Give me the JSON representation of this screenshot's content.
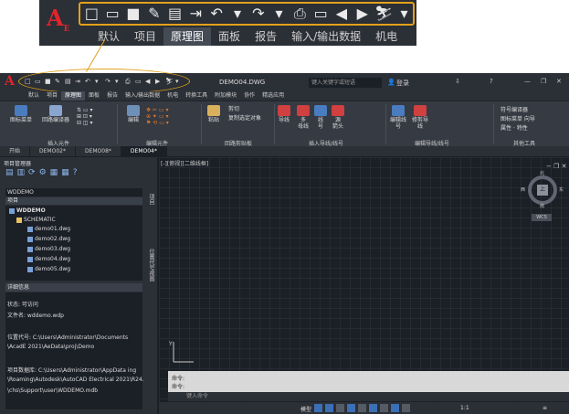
{
  "zoom": {
    "qa_icons": [
      "□",
      "▭",
      "■",
      "✎",
      "▤",
      "⇥",
      "↶",
      "▾",
      "↷",
      "▾",
      "⎙",
      "▭",
      "◀",
      "▶",
      "⛷",
      "▾"
    ],
    "tabs": [
      "默认",
      "项目",
      "原理图",
      "面板",
      "报告",
      "输入/输出数据",
      "机电"
    ],
    "active_tab": "原理图",
    "logo": "A",
    "logo_sub": "E"
  },
  "app": {
    "title": "DEMO04.DWG",
    "search_placeholder": "键入关键字或短语",
    "login": "登录",
    "ribbon_tabs": [
      "默认",
      "项目",
      "原理图",
      "面板",
      "报告",
      "输入/输出数据",
      "机电",
      "转换工具",
      "附加模块",
      "协作",
      "精选应用",
      ""
    ],
    "active_ribbon_tab": "原理图",
    "panels": {
      "insert": "插入元件",
      "edit": "编辑元件",
      "clipboard": "回路剪贴板",
      "wire": "插入导线/线号",
      "edit_wire": "编辑导线/线号",
      "other": "其他工具"
    },
    "buttons": {
      "icon_menu": "图标菜单",
      "circuit_builder": "回路编译器",
      "edit": "编辑",
      "paste": "粘贴",
      "cut": "剪切",
      "copy_clip": "复制选定对象",
      "wire": "导线",
      "multi": "多",
      "multi2": "母线",
      "line": "线",
      "line2": "号",
      "source": "源",
      "source2": "箭头",
      "edit_wire": "编辑线",
      "edit_wire2": "号",
      "modify_wire": "修剪导",
      "modify_wire2": "线",
      "symbol_builder": "符号编译器",
      "icon_menu_wizard": "图标菜单 向导",
      "attributes": "属性 · 特性"
    },
    "doc_tabs": [
      "开始",
      "DEMO02*",
      "DEMO08*",
      "DEMO04*"
    ],
    "active_doc": "DEMO04*",
    "project_manager": {
      "title": "项目管理器",
      "project": "WDDEMO",
      "section": "项目",
      "root": "WDDEMO",
      "folder": "SCHEMATIC",
      "files": [
        "demo01.dwg",
        "demo02.dwg",
        "demo03.dwg",
        "demo04.dwg",
        "demo05.dwg"
      ]
    },
    "details": {
      "title": "详细信息",
      "status": "状态: 可访问",
      "filename": "文件名: wddemo.wdp",
      "location_1": "位置代号: C:\\Users\\Administrator\\Documents",
      "location_2": "\\AcadE 2021\\AeData\\proj\\Demo",
      "db_1": "项目数据库: C:\\Users\\Administrator\\AppData ing",
      "db_2": "\\Roaming\\Autodesk\\AutoCAD Electrical 2021\\R24.0",
      "db_3": "\\chs\\Support\\user\\WDDEMO.mdb"
    },
    "side_labels": [
      "项目",
      "位置代号视图"
    ],
    "viewport": "[-][俯视][二维线框]",
    "view_cube": {
      "top": "上",
      "n": "北",
      "e": "东",
      "w": "西",
      "s": "南",
      "wcs": "WCS"
    },
    "command_history": [
      "命令:",
      "命令:"
    ],
    "command_input": "键入命令",
    "model": "模型",
    "scale": "1:1"
  }
}
